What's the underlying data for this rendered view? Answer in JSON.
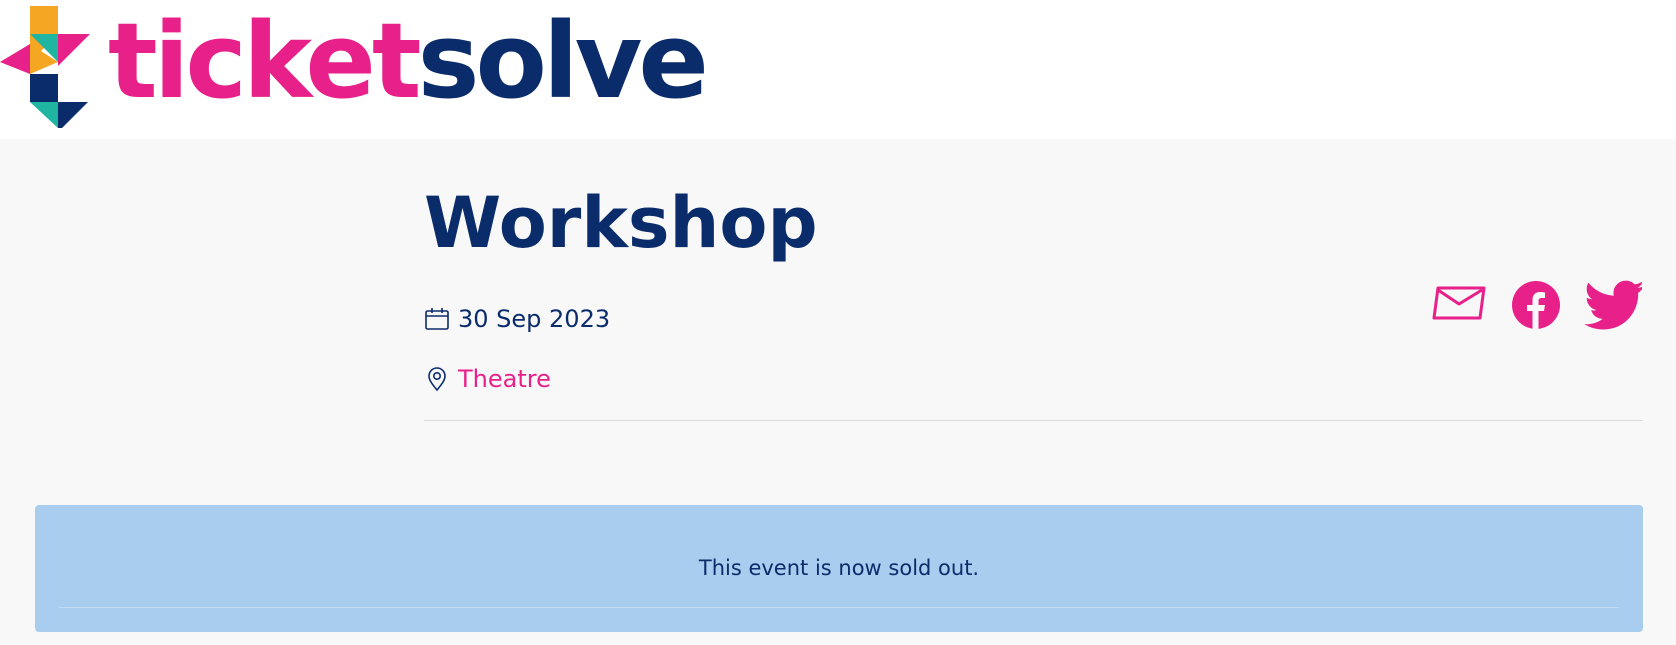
{
  "brand": {
    "name_part1": "ticket",
    "name_part2": "solve",
    "colors": {
      "pink": "#e8208a",
      "navy": "#0b2c6b",
      "orange": "#f5a623",
      "teal": "#1fb5a0"
    }
  },
  "event": {
    "title": "Workshop",
    "date": "30 Sep 2023",
    "venue": "Theatre"
  },
  "icons": {
    "date": "calendar-icon",
    "venue": "map-pin-icon",
    "share": [
      "mail-icon",
      "facebook-icon",
      "twitter-icon"
    ]
  },
  "notice": {
    "message": "This event is now sold out.",
    "background": "#a9cdee"
  }
}
